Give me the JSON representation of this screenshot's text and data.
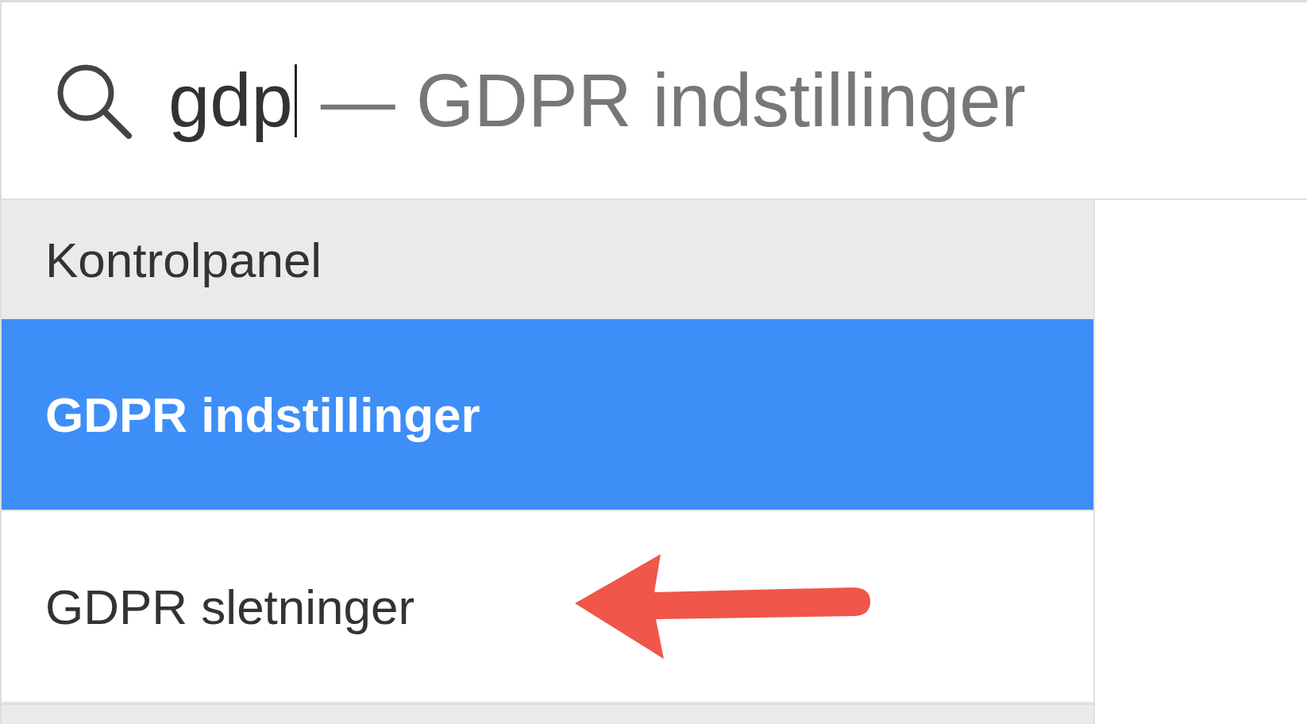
{
  "search": {
    "value": "gdp",
    "completion": "— GDPR indstillinger"
  },
  "results": [
    {
      "kind": "header",
      "label": "Kontrolpanel"
    },
    {
      "kind": "option",
      "label": "GDPR indstillinger",
      "selected": true,
      "annotated": false
    },
    {
      "kind": "option",
      "label": "GDPR sletninger",
      "selected": false,
      "annotated": true
    },
    {
      "kind": "header"
    }
  ]
}
